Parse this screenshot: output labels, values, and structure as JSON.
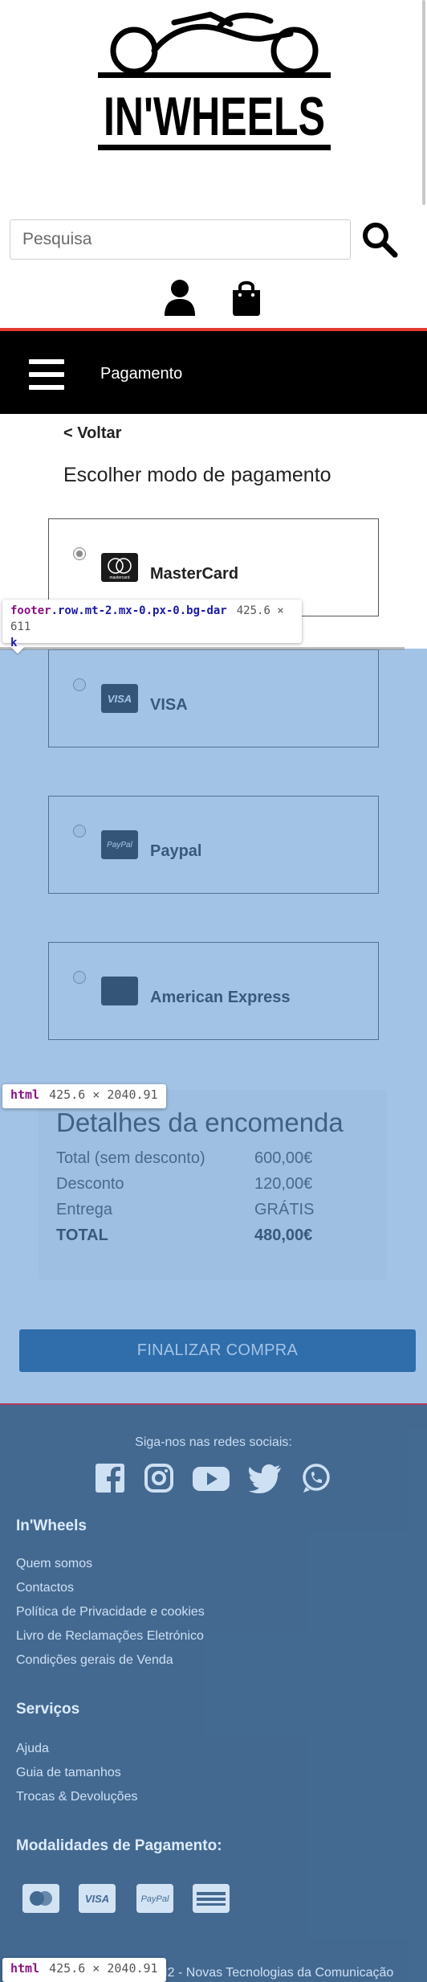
{
  "header": {
    "logo_text": "IN'WHEELS",
    "search": {
      "placeholder": "Pesquisa"
    },
    "icons": {
      "search": "search-icon",
      "user": "user-icon",
      "bag": "shopping-bag-icon"
    },
    "nav": {
      "title": "Pagamento",
      "menu_icon": "hamburger-menu-icon"
    }
  },
  "checkout": {
    "back_label": "< Voltar",
    "heading": "Escolher modo de pagamento",
    "methods": [
      {
        "label": "MasterCard",
        "selected": true,
        "icon": "mastercard-icon"
      },
      {
        "label": "VISA",
        "selected": false,
        "icon": "visa-icon"
      },
      {
        "label": "Paypal",
        "selected": false,
        "icon": "paypal-icon"
      },
      {
        "label": "American Express",
        "selected": false,
        "icon": "amex-icon"
      }
    ],
    "summary": {
      "title": "Detalhes da encomenda",
      "rows": [
        {
          "label": "Total (sem desconto)",
          "value": "600,00€"
        },
        {
          "label": "Desconto",
          "value": "120,00€"
        },
        {
          "label": "Entrega",
          "value": "GRÁTIS"
        },
        {
          "label": "TOTAL",
          "value": "480,00€"
        }
      ]
    },
    "finalize_label": "FINALIZAR COMPRA"
  },
  "footer": {
    "social_title": "Siga-nos nas redes sociais:",
    "social_icons": [
      "facebook-icon",
      "instagram-icon",
      "youtube-icon",
      "twitter-icon",
      "whatsapp-icon"
    ],
    "section1": {
      "heading": "In'Wheels",
      "links": [
        "Quem somos",
        "Contactos",
        "Política de Privacidade e cookies",
        "Livro de Reclamações Eletrónico",
        "Condições gerais de Venda"
      ]
    },
    "section2": {
      "heading": "Serviços",
      "links": [
        "Ajuda",
        "Guia de tamanhos",
        "Trocas & Devoluções"
      ]
    },
    "payments_heading": "Modalidades de Pagamento:",
    "payment_logos": [
      "MasterCard",
      "VISA",
      "PayPal",
      "American Express"
    ],
    "copyright": "MM2 - Novas Tecnologias da Comunicação"
  },
  "devtools": {
    "tooltip_footer": {
      "tag": "footer",
      "classes": ".row.mt-2.mx-0.px-0.bg-dar",
      "wrap": "k",
      "size": "425.6 × 611"
    },
    "tooltip_html": {
      "tag": "html",
      "size": "425.6 × 2040.91"
    }
  },
  "colors": {
    "accent_red": "#e23a2e",
    "nav_bg": "#000000",
    "button_blue": "#0d4d84",
    "footer_bg": "#0f355c",
    "overlay_blue": "#4e8cd0"
  }
}
